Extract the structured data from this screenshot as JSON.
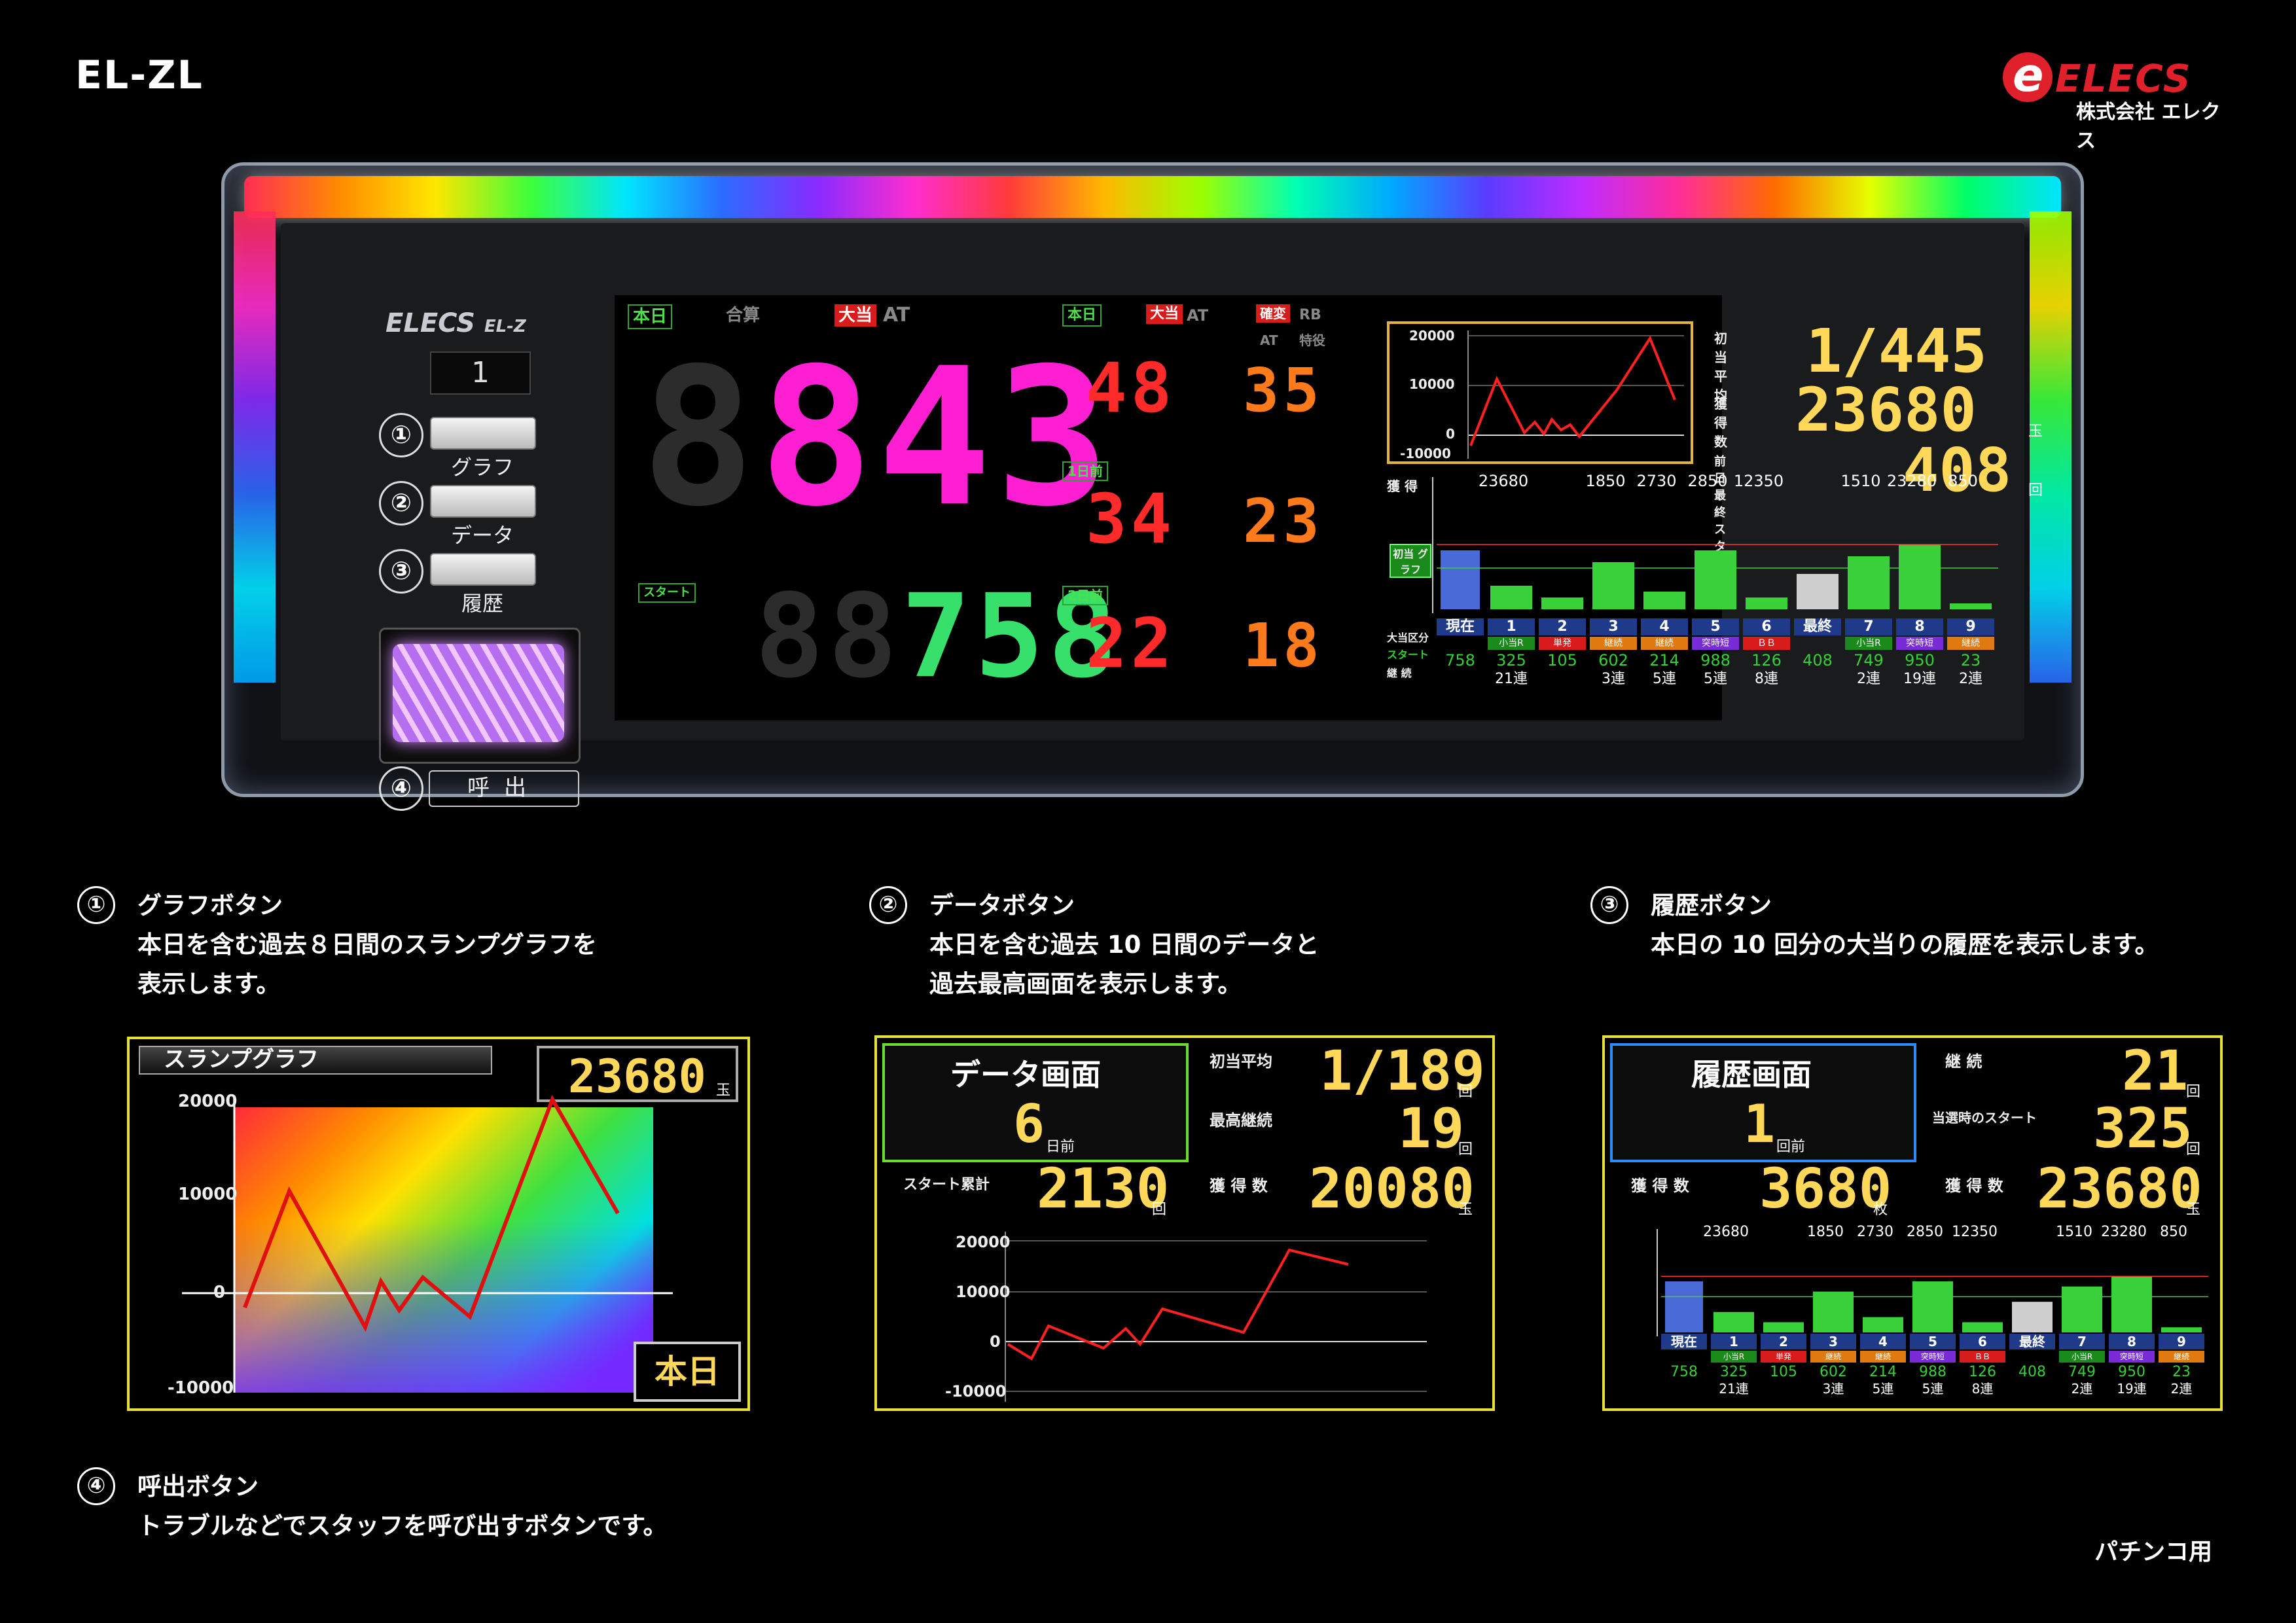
{
  "header": {
    "model": "EL-ZL",
    "brand": "ELECS",
    "brand_sub": "株式会社 エレクス",
    "brand_mark": "e"
  },
  "device": {
    "logo": "ELECS",
    "logo_model": "EL-Z",
    "unit_number": "1",
    "buttons": [
      {
        "num": "①",
        "label": "グラフ"
      },
      {
        "num": "②",
        "label": "データ"
      },
      {
        "num": "③",
        "label": "履歴"
      }
    ],
    "call": {
      "num": "④",
      "label": "呼出"
    },
    "tags": {
      "today": "本日",
      "total": "合算",
      "bigwin": "大当",
      "at": "AT",
      "rb": "RB",
      "kakuhen": "確変",
      "tokyu": "特役",
      "start": "スタート",
      "day1": "1日前",
      "day2": "2日前"
    },
    "main_count": "843",
    "main_count_ghost": "8",
    "start_count": "758",
    "start_ghost": "88",
    "side_rows": [
      {
        "a": "48",
        "b": "35"
      },
      {
        "a": "34",
        "b": "23"
      },
      {
        "a": "22",
        "b": "18"
      }
    ],
    "graph": {
      "yticks": [
        "20000",
        "10000",
        "0",
        "-10000"
      ]
    },
    "stats": {
      "first_avg_label": "初当平均",
      "first_avg": "1/445",
      "gain_label": "獲 得 数",
      "gain": "23680",
      "gain_unit": "玉",
      "prev_start_label": "前日最終スタート",
      "prev_start": "408",
      "prev_unit": "回"
    },
    "history": {
      "row_labels": [
        "獲 得",
        "大当区分",
        "スタート",
        "継 続"
      ],
      "side_label": "初当 グラフ",
      "top_values": [
        "23680",
        "1850",
        "2730",
        "2850",
        "12350",
        "1510",
        "23280",
        "850"
      ],
      "cols": [
        {
          "head": "現在",
          "kind": "",
          "start": "758",
          "cont": ""
        },
        {
          "head": "1",
          "kind": "小当R",
          "start": "325",
          "cont": "21連"
        },
        {
          "head": "2",
          "kind": "単発",
          "start": "105",
          "cont": ""
        },
        {
          "head": "3",
          "kind": "継続",
          "start": "602",
          "cont": "3連"
        },
        {
          "head": "4",
          "kind": "継続",
          "start": "214",
          "cont": "5連"
        },
        {
          "head": "5",
          "kind": "突時短",
          "start": "988",
          "cont": "5連"
        },
        {
          "head": "6",
          "kind": "ＢＢ",
          "start": "126",
          "cont": "8連"
        },
        {
          "head": "最終",
          "kind": "",
          "start": "408",
          "cont": ""
        },
        {
          "head": "7",
          "kind": "小当R",
          "start": "749",
          "cont": "2連"
        },
        {
          "head": "8",
          "kind": "突時短",
          "start": "950",
          "cont": "19連"
        },
        {
          "head": "9",
          "kind": "継続",
          "start": "23",
          "cont": "2連"
        }
      ],
      "bars": [
        4,
        2,
        8,
        3,
        10,
        2,
        6,
        9,
        11,
        1
      ]
    }
  },
  "desc": [
    {
      "num": "①",
      "title": "グラフボタン",
      "line1": "本日を含む過去８日間のスランプグラフを",
      "line2": "表示します。"
    },
    {
      "num": "②",
      "title": "データボタン",
      "line1": "本日を含む過去 10 日間のデータと",
      "line2": "過去最高画面を表示します。"
    },
    {
      "num": "③",
      "title": "履歴ボタン",
      "line1": "本日の 10 回分の大当りの履歴を表示します。",
      "line2": ""
    },
    {
      "num": "④",
      "title": "呼出ボタン",
      "line1": "トラブルなどでスタッフを呼び出すボタンです。",
      "line2": ""
    }
  ],
  "panel1": {
    "title": "スランプグラフ",
    "value": "23680",
    "unit": "玉",
    "day": "本日",
    "yticks": [
      "20000",
      "10000",
      "0",
      "-10000"
    ]
  },
  "panel2": {
    "title": "データ画面",
    "day": "6",
    "day_unit": "日前",
    "first_avg_label": "初当平均",
    "first_avg": "1/189",
    "first_unit": "回",
    "max_cont_label": "最高継続",
    "max_cont": "19",
    "max_unit": "回",
    "start_total_label": "スタート累計",
    "start_total": "2130",
    "start_unit": "回",
    "gain_label": "獲 得 数",
    "gain": "20080",
    "gain_unit": "玉",
    "yticks": [
      "20000",
      "10000",
      "0",
      "-10000"
    ]
  },
  "panel3": {
    "title": "履歴画面",
    "num": "1",
    "num_unit": "回前",
    "cont_label": "継 続",
    "cont": "21",
    "cont_unit": "回",
    "hit_start_label": "当選時のスタート",
    "hit_start": "325",
    "hit_unit": "回",
    "gain_label": "獲 得 数",
    "gain": "3680",
    "gain_unit": "枚",
    "gain2_label": "獲 得 数",
    "gain2": "23680",
    "gain2_unit": "玉"
  },
  "footer": {
    "note": "パチンコ用"
  },
  "colors": {
    "gold": "#e5e03a",
    "magenta": "#ff1fd2",
    "green": "#37e06a",
    "red": "#ff2a2a",
    "orange": "#ff7a1a",
    "yellow_num": "#ffd85a"
  }
}
